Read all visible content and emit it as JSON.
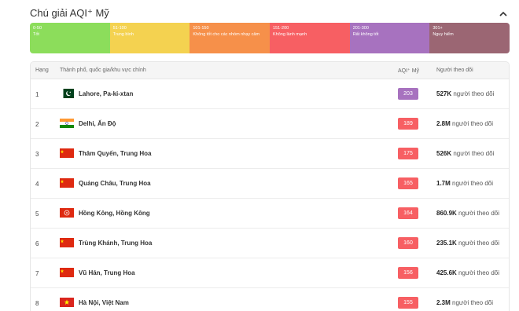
{
  "legend": {
    "title": "Chú giải AQI⁺ Mỹ",
    "segments": [
      {
        "range": "0-50",
        "label": "Tốt",
        "color": "#8cdd5b"
      },
      {
        "range": "51-100",
        "label": "Trung bình",
        "color": "#f4d250"
      },
      {
        "range": "101-150",
        "label": "Không tốt cho các nhóm nhạy cảm",
        "color": "#f6904a"
      },
      {
        "range": "151-200",
        "label": "Không lành mạnh",
        "color": "#f75f63"
      },
      {
        "range": "201-300",
        "label": "Rất không tốt",
        "color": "#a772bf"
      },
      {
        "range": "301+",
        "label": "Nguy hiểm",
        "color": "#9b6673"
      }
    ]
  },
  "table": {
    "headers": {
      "rank": "Hạng",
      "city": "Thành phố, quốc gia/khu vực chính",
      "aqi": "AQI⁺ Mỹ",
      "followers": "Người theo dõi"
    },
    "rows": [
      {
        "rank": "1",
        "city": "Lahore, Pa-ki-xtan",
        "aqi": "203",
        "aqi_color": "#a772bf",
        "followers": "527K",
        "suffix": "người theo dõi",
        "flag": "pakistan-flag-icon"
      },
      {
        "rank": "2",
        "city": "Delhi, Ấn Độ",
        "aqi": "189",
        "aqi_color": "#f75f63",
        "followers": "2.8M",
        "suffix": "người theo dõi",
        "flag": "india-flag-icon"
      },
      {
        "rank": "3",
        "city": "Thâm Quyến, Trung Hoa",
        "aqi": "175",
        "aqi_color": "#f75f63",
        "followers": "526K",
        "suffix": "người theo dõi",
        "flag": "china-flag-icon"
      },
      {
        "rank": "4",
        "city": "Quảng Châu, Trung Hoa",
        "aqi": "165",
        "aqi_color": "#f75f63",
        "followers": "1.7M",
        "suffix": "người theo dõi",
        "flag": "china-flag-icon"
      },
      {
        "rank": "5",
        "city": "Hồng Kông, Hồng Kông",
        "aqi": "164",
        "aqi_color": "#f75f63",
        "followers": "860.9K",
        "suffix": "người theo dõi",
        "flag": "hong-kong-flag-icon"
      },
      {
        "rank": "6",
        "city": "Trùng Khánh, Trung Hoa",
        "aqi": "160",
        "aqi_color": "#f75f63",
        "followers": "235.1K",
        "suffix": "người theo dõi",
        "flag": "china-flag-icon"
      },
      {
        "rank": "7",
        "city": "Vũ Hán, Trung Hoa",
        "aqi": "156",
        "aqi_color": "#f75f63",
        "followers": "425.6K",
        "suffix": "người theo dõi",
        "flag": "china-flag-icon"
      },
      {
        "rank": "8",
        "city": "Hà Nội, Việt Nam",
        "aqi": "155",
        "aqi_color": "#f75f63",
        "followers": "2.3M",
        "suffix": "người theo dõi",
        "flag": "vietnam-flag-icon"
      }
    ]
  }
}
